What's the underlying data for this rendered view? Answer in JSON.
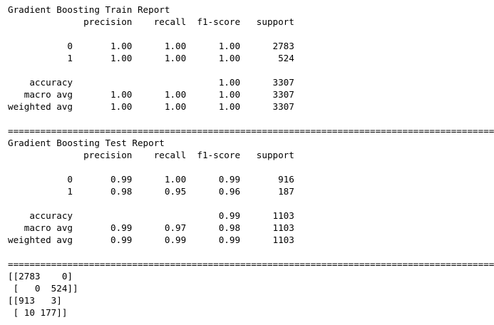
{
  "output_lines": [
    "Gradient Boosting Train Report",
    "              precision    recall  f1-score   support",
    "",
    "           0       1.00      1.00      1.00      2783",
    "           1       1.00      1.00      1.00       524",
    "",
    "    accuracy                           1.00      3307",
    "   macro avg       1.00      1.00      1.00      3307",
    "weighted avg       1.00      1.00      1.00      3307",
    "",
    "==========================================================================================",
    "Gradient Boosting Test Report",
    "              precision    recall  f1-score   support",
    "",
    "           0       0.99      1.00      0.99       916",
    "           1       0.98      0.95      0.96       187",
    "",
    "    accuracy                           0.99      1103",
    "   macro avg       0.99      0.97      0.98      1103",
    "weighted avg       0.99      0.99      0.99      1103",
    "",
    "==========================================================================================",
    "[[2783    0]",
    " [   0  524]]",
    "[[913   3]",
    " [ 10 177]]"
  ]
}
